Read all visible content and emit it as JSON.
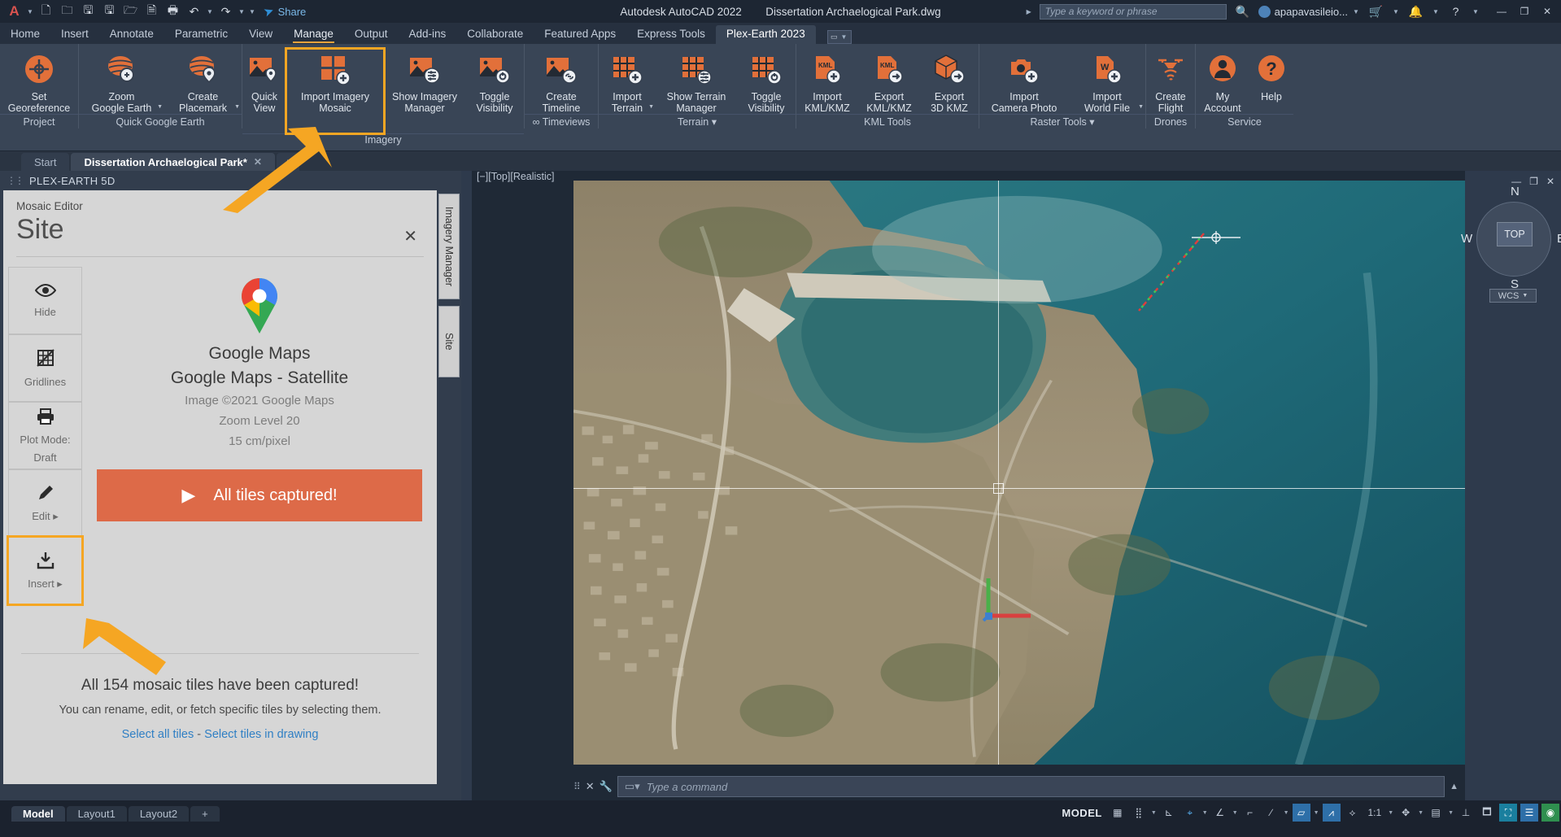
{
  "titlebar": {
    "logo": "autodesk-logo",
    "quick_access": [
      "new-icon",
      "open-icon",
      "save-icon",
      "save-as-icon",
      "open-from-web-icon",
      "plot-preview-icon",
      "print-icon",
      "undo-icon",
      "redo-icon"
    ],
    "share_label": "Share",
    "app_title": "Autodesk AutoCAD 2022",
    "document_title": "Dissertation Archaelogical Park.dwg",
    "search_placeholder": "Type a keyword or phrase",
    "user_name": "apapavasileio...",
    "window_buttons": [
      "minimize",
      "restore",
      "close"
    ]
  },
  "ribbon": {
    "tabs": [
      {
        "label": "Home",
        "state": "normal"
      },
      {
        "label": "Insert",
        "state": "normal"
      },
      {
        "label": "Annotate",
        "state": "normal"
      },
      {
        "label": "Parametric",
        "state": "normal"
      },
      {
        "label": "View",
        "state": "normal"
      },
      {
        "label": "Manage",
        "state": "hover"
      },
      {
        "label": "Output",
        "state": "normal"
      },
      {
        "label": "Add-ins",
        "state": "normal"
      },
      {
        "label": "Collaborate",
        "state": "normal"
      },
      {
        "label": "Featured Apps",
        "state": "normal"
      },
      {
        "label": "Express Tools",
        "state": "normal"
      },
      {
        "label": "Plex-Earth 2023",
        "state": "active"
      }
    ],
    "panels": [
      {
        "name": "Project",
        "buttons": [
          {
            "line1": "Set",
            "line2": "Georeference",
            "icon": "set-georeference-icon",
            "dropdown": false,
            "highlighted": false
          }
        ]
      },
      {
        "name": "Quick Google Earth",
        "buttons": [
          {
            "line1": "Zoom",
            "line2": "Google Earth",
            "icon": "zoom-google-earth-icon",
            "dropdown": true,
            "highlighted": false
          },
          {
            "line1": "Create",
            "line2": "Placemark",
            "icon": "create-placemark-icon",
            "dropdown": true,
            "highlighted": false
          }
        ]
      },
      {
        "name": "Imagery",
        "buttons": [
          {
            "line1": "Quick",
            "line2": "View",
            "icon": "quick-view-icon",
            "dropdown": false,
            "highlighted": false
          },
          {
            "line1": "Import Imagery",
            "line2": "Mosaic",
            "icon": "import-imagery-mosaic-icon",
            "dropdown": false,
            "highlighted": true
          },
          {
            "line1": "Show Imagery",
            "line2": "Manager",
            "icon": "show-imagery-manager-icon",
            "dropdown": false,
            "highlighted": false
          },
          {
            "line1": "Toggle",
            "line2": "Visibility",
            "icon": "toggle-visibility-icon",
            "dropdown": false,
            "highlighted": false
          }
        ]
      },
      {
        "name": "∞ Timeviews",
        "buttons": [
          {
            "line1": "Create",
            "line2": "Timeline",
            "icon": "create-timeline-icon",
            "dropdown": false,
            "highlighted": false
          }
        ]
      },
      {
        "name": "Terrain ▾",
        "buttons": [
          {
            "line1": "Import",
            "line2": "Terrain",
            "icon": "import-terrain-icon",
            "dropdown": true,
            "highlighted": false
          },
          {
            "line1": "Show Terrain",
            "line2": "Manager",
            "icon": "show-terrain-manager-icon",
            "dropdown": false,
            "highlighted": false
          },
          {
            "line1": "Toggle",
            "line2": "Visibility",
            "icon": "toggle-terrain-visibility-icon",
            "dropdown": false,
            "highlighted": false
          }
        ]
      },
      {
        "name": "KML Tools",
        "buttons": [
          {
            "line1": "Import",
            "line2": "KML/KMZ",
            "icon": "import-kml-icon",
            "dropdown": false,
            "highlighted": false
          },
          {
            "line1": "Export",
            "line2": "KML/KMZ",
            "icon": "export-kml-icon",
            "dropdown": false,
            "highlighted": false
          },
          {
            "line1": "Export",
            "line2": "3D KMZ",
            "icon": "export-3d-kmz-icon",
            "dropdown": false,
            "highlighted": false
          }
        ]
      },
      {
        "name": "Raster Tools ▾",
        "buttons": [
          {
            "line1": "Import",
            "line2": "Camera Photo",
            "icon": "import-camera-photo-icon",
            "dropdown": false,
            "highlighted": false
          },
          {
            "line1": "Import",
            "line2": "World File",
            "icon": "import-world-file-icon",
            "dropdown": true,
            "highlighted": false
          }
        ]
      },
      {
        "name": "Drones",
        "buttons": [
          {
            "line1": "Create",
            "line2": "Flight",
            "icon": "create-flight-icon",
            "dropdown": false,
            "highlighted": false
          }
        ]
      },
      {
        "name": "Service",
        "buttons": [
          {
            "line1": "My",
            "line2": "Account",
            "icon": "my-account-icon",
            "dropdown": false,
            "highlighted": false
          },
          {
            "line1": "",
            "line2": "Help",
            "icon": "help-icon",
            "dropdown": false,
            "highlighted": false
          }
        ]
      }
    ]
  },
  "drawing_tabs": [
    {
      "label": "Start",
      "active": false,
      "closable": false
    },
    {
      "label": "Dissertation Archaelogical Park*",
      "active": true,
      "closable": true
    },
    {
      "label": "+",
      "active": false,
      "closable": false
    }
  ],
  "dock": {
    "title": "PLEX-EARTH 5D",
    "vertical_tabs": [
      "Imagery Manager",
      "Site"
    ],
    "editor": {
      "subtitle": "Mosaic Editor",
      "title": "Site",
      "close_icon": "close-icon",
      "side_buttons": [
        {
          "label": "Hide",
          "icon": "eye-icon",
          "arrow": false
        },
        {
          "label": "Gridlines",
          "icon": "gridlines-off-icon",
          "arrow": false
        },
        {
          "label": "Plot Mode:",
          "label2": "Draft",
          "icon": "printer-icon",
          "arrow": false
        },
        {
          "label": "Edit",
          "icon": "pencil-icon",
          "arrow": true
        },
        {
          "label": "Insert",
          "icon": "download-icon",
          "arrow": true,
          "highlighted": true
        }
      ],
      "provider_logo": "google-maps-pin-icon",
      "provider_name": "Google Maps",
      "provider_layer": "Google Maps - Satellite",
      "copyright": "Image ©2021 Google Maps",
      "zoom_level": "Zoom Level 20",
      "resolution": "15 cm/pixel",
      "capture_button": "All tiles captured!",
      "capture_icon": "play-icon",
      "footer_title": "All 154 mosaic tiles have been captured!",
      "footer_text": "You can rename, edit, or fetch specific tiles by selecting them.",
      "link_all": "Select all tiles",
      "link_sep": "-",
      "link_drawing": "Select tiles in drawing"
    }
  },
  "viewport": {
    "header": "[−][Top][Realistic]",
    "command_placeholder": "Type a command",
    "command_icons": [
      "drag-handle",
      "close-icon",
      "wrench-icon",
      "command-prompt-icon"
    ],
    "scroll_up_icon": "chevron-up-icon"
  },
  "navcube": {
    "north": "N",
    "south": "S",
    "east": "E",
    "west": "W",
    "face": "TOP",
    "ucs": "WCS",
    "window_controls": [
      "minimize",
      "restore",
      "close"
    ]
  },
  "statusbar": {
    "layout_tabs": [
      {
        "label": "Model",
        "active": true
      },
      {
        "label": "Layout1",
        "active": false
      },
      {
        "label": "Layout2",
        "active": false
      },
      {
        "label": "+",
        "active": false
      }
    ],
    "model_label": "MODEL",
    "scale": "1:1",
    "tools": [
      "grid-icon",
      "snap-icon",
      "ortho-icon",
      "polar-icon",
      "osnap-icon",
      "otrack-icon",
      "lineweight-icon",
      "transparency-icon",
      "selection-cycling-icon",
      "annotation-monitor-icon",
      "workspace-icon",
      "customize-icon",
      "fullscreen-icon",
      "hardware-accel-icon",
      "isolate-icon"
    ]
  },
  "colors": {
    "accent_orange": "#e2703a",
    "highlight_orange": "#f5a623",
    "capture_button": "#dd6a48",
    "link_blue": "#2f7fc4",
    "ribbon_bg": "#394556",
    "panel_bg": "#d6d6d6"
  }
}
